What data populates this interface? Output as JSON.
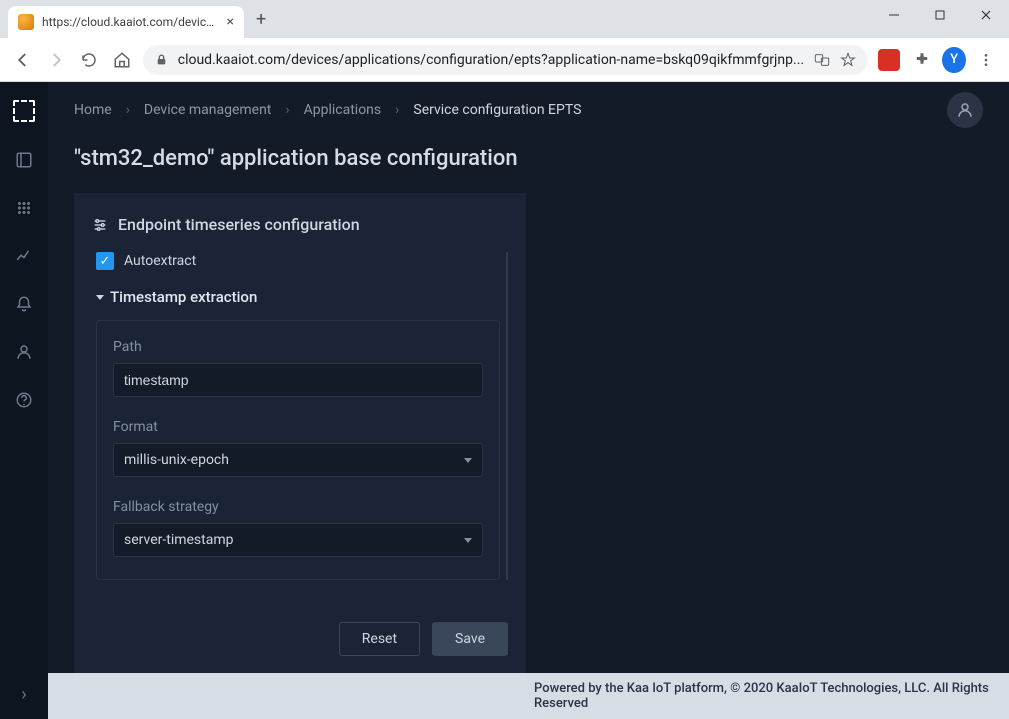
{
  "browser": {
    "tab_title": "https://cloud.kaaiot.com/devices",
    "url_display": "cloud.kaaiot.com/devices/applications/configuration/epts?application-name=bskq09qikfmmfgrjnp...",
    "avatar_letter": "Y"
  },
  "breadcrumbs": {
    "items": [
      "Home",
      "Device management",
      "Applications",
      "Service configuration EPTS"
    ]
  },
  "page": {
    "title": "\"stm32_demo\" application base configuration"
  },
  "panel": {
    "title": "Endpoint timeseries configuration",
    "autoextract_label": "Autoextract",
    "autoextract_checked": true,
    "section_title": "Timestamp extraction",
    "fields": {
      "path_label": "Path",
      "path_value": "timestamp",
      "format_label": "Format",
      "format_value": "millis-unix-epoch",
      "fallback_label": "Fallback strategy",
      "fallback_value": "server-timestamp"
    },
    "buttons": {
      "reset": "Reset",
      "save": "Save"
    }
  },
  "footer": {
    "text": "Powered by the Kaa IoT platform, © 2020 KaaIoT Technologies, LLC. All Rights Reserved"
  }
}
